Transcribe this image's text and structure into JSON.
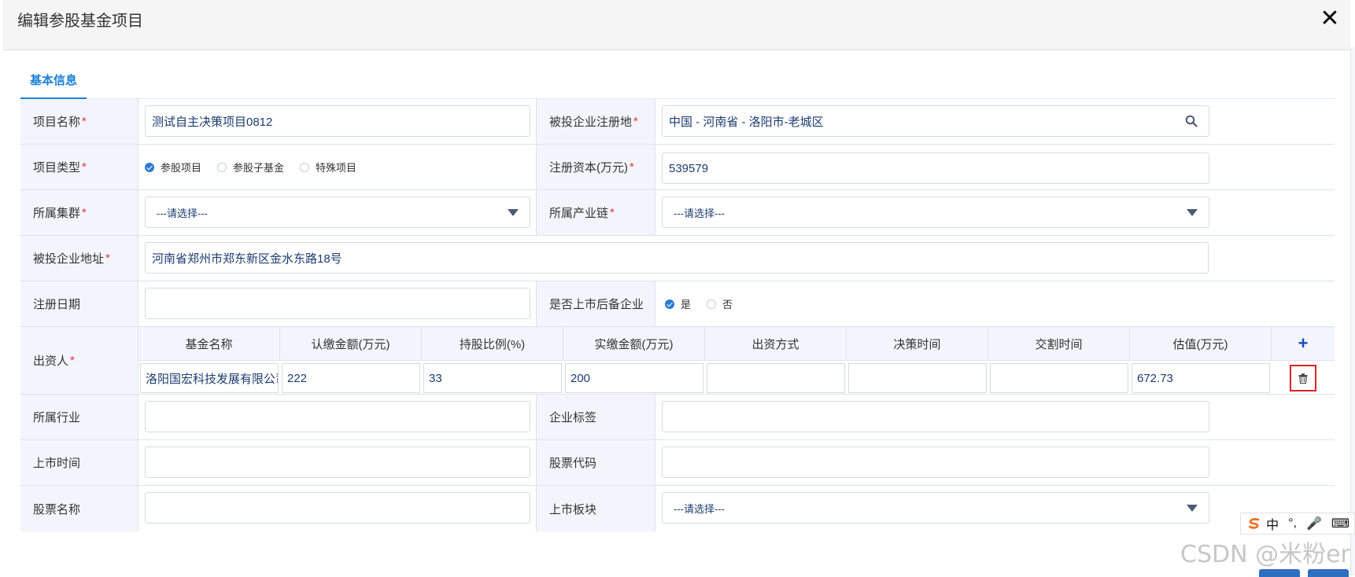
{
  "dialog": {
    "title": "编辑参股基金项目",
    "close": "✕"
  },
  "tabs": [
    {
      "label": "基本信息"
    }
  ],
  "required_mark": "*",
  "fields": {
    "project_name": {
      "label": "项目名称",
      "value": "测试自主决策项目0812"
    },
    "reg_place": {
      "label": "被投企业注册地",
      "value": "中国 - 河南省 - 洛阳市-老城区"
    },
    "project_type": {
      "label": "项目类型",
      "options": [
        {
          "label": "参股项目",
          "checked": true
        },
        {
          "label": "参股子基金",
          "checked": false
        },
        {
          "label": "特殊项目",
          "checked": false
        }
      ]
    },
    "reg_capital": {
      "label": "注册资本(万元)",
      "value": "539579"
    },
    "cluster": {
      "label": "所属集群",
      "value": "---请选择---"
    },
    "industry_chain": {
      "label": "所属产业链",
      "value": "---请选择---"
    },
    "address": {
      "label": "被投企业地址",
      "value": "河南省郑州市郑东新区金水东路18号"
    },
    "reg_date": {
      "label": "注册日期",
      "value": ""
    },
    "listed_reserve": {
      "label": "是否上市后备企业",
      "options": [
        {
          "label": "是",
          "checked": true
        },
        {
          "label": "否",
          "checked": false
        }
      ]
    },
    "investor": {
      "label": "出资人",
      "columns": [
        "基金名称",
        "认缴金额(万元)",
        "持股比例(%)",
        "实缴金额(万元)",
        "出资方式",
        "决策时间",
        "交割时间",
        "估值(万元)"
      ],
      "add_label": "+",
      "rows": [
        [
          "洛阳国宏科技发展有限公司",
          "222",
          "33",
          "200",
          "",
          "",
          "",
          "672.73"
        ]
      ]
    },
    "industry": {
      "label": "所属行业",
      "value": ""
    },
    "tag": {
      "label": "企业标签",
      "value": ""
    },
    "listing_time": {
      "label": "上市时间",
      "value": ""
    },
    "stock_code": {
      "label": "股票代码",
      "value": ""
    },
    "stock_name": {
      "label": "股票名称",
      "value": ""
    },
    "board": {
      "label": "上市板块",
      "value": "---请选择---"
    }
  },
  "ime": {
    "items": [
      "中",
      "°,",
      "🎤",
      "⌨"
    ]
  },
  "watermark": "CSDN @米粉er"
}
